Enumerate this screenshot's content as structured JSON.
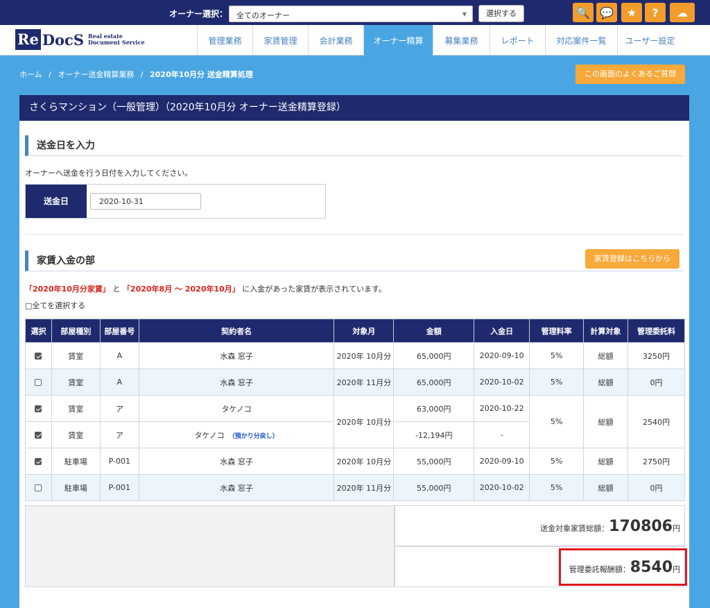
{
  "topbar": {
    "owner_label": "オーナー選択：",
    "owner_select_value": "全てのオーナー",
    "select_button": "選択する",
    "icons": [
      "search-icon",
      "chat-icon",
      "star-icon",
      "help-icon",
      "cloud-icon"
    ],
    "icon_glyphs": [
      "🔍",
      "💬",
      "★",
      "?",
      "☁"
    ]
  },
  "logo": {
    "re": "Re",
    "docs": "DocS",
    "sub1": "Real estate",
    "sub2": "Document Service"
  },
  "nav": {
    "items": [
      {
        "label": "管理業務"
      },
      {
        "label": "家賃管理"
      },
      {
        "label": "会計業務"
      },
      {
        "label": "オーナー精算"
      },
      {
        "label": "募集業務"
      },
      {
        "label": "レポート"
      },
      {
        "label": "対応案件一覧"
      },
      {
        "label": "ユーザー設定"
      }
    ]
  },
  "breadcrumb": {
    "home": "ホーム",
    "sep": "/",
    "level1": "オーナー送金精算業務",
    "current": "2020年10月分 送金精算処理"
  },
  "faq_button": "この画面のよくあるご質問",
  "panel": {
    "title": "さくらマンション（一般管理）（2020年10月分 オーナー送金精算登録）"
  },
  "send_date": {
    "section_title": "送金日を入力",
    "desc": "オーナーへ送金を行う日付を入力してください。",
    "label": "送金日",
    "value": "2020-10-31"
  },
  "rent": {
    "section_title": "家賃入金の部",
    "register_button": "家賃登録はこちらから",
    "desc_red1": "「2020年10月分家賃」",
    "desc_mid": "と",
    "desc_red2": "「2020年8月 ～ 2020年10月」",
    "desc_tail": "に入金があった家賃が表示されています。",
    "select_all": "□全てを選択する"
  },
  "table": {
    "headers": [
      "選択",
      "部屋種別",
      "部屋番号",
      "契約者名",
      "対象月",
      "金額",
      "入金日",
      "管理料率",
      "計算対象",
      "管理委託料"
    ],
    "rows": [
      {
        "type": "賃室",
        "room": "A",
        "name": "水森 窓子",
        "month": "2020年 10月分",
        "amount": "65,000円",
        "date": "2020-09-10",
        "rate": "5%",
        "target": "総額",
        "fee": "3250円"
      },
      {
        "type": "賃室",
        "room": "A",
        "name": "水森 窓子",
        "month": "2020年 11月分",
        "amount": "65,000円",
        "date": "2020-10-02",
        "rate": "5%",
        "target": "総額",
        "fee": "0円"
      },
      {
        "type": "賃室",
        "room": "ア",
        "name": "タケノコ",
        "month": "2020年 10月分",
        "amount": "63,000円",
        "date": "2020-10-22",
        "rate": "5%",
        "target": "総額",
        "fee": "2540円"
      },
      {
        "type": "賃室",
        "room": "ア",
        "name": "タケノコ",
        "note": "（預かり分戻し）",
        "amount": "-12,194円",
        "date": "-"
      },
      {
        "type": "駐車場",
        "room": "P-001",
        "name": "水森 窓子",
        "month": "2020年 10月分",
        "amount": "55,000円",
        "date": "2020-09-10",
        "rate": "5%",
        "target": "総額",
        "fee": "2750円"
      },
      {
        "type": "駐車場",
        "room": "P-001",
        "name": "水森 窓子",
        "month": "2020年 11月分",
        "amount": "55,000円",
        "date": "2020-10-02",
        "rate": "5%",
        "target": "総額",
        "fee": "0円"
      }
    ]
  },
  "summary": {
    "total_label": "送金対象家賃総額：",
    "total_value": "170806",
    "fee_label": "管理委託報酬額：",
    "fee_value": "8540",
    "unit": "円"
  }
}
